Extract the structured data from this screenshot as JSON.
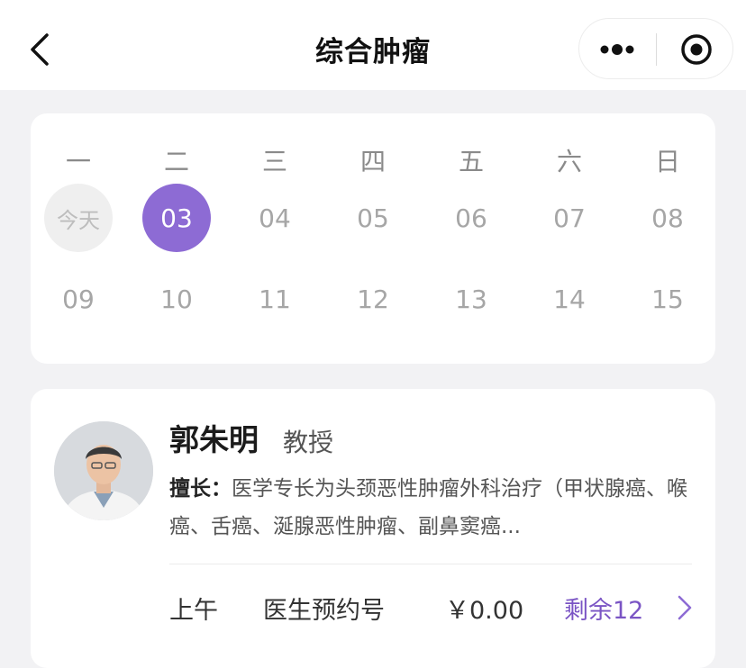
{
  "nav": {
    "title": "综合肿瘤",
    "back_icon": "chevron-left-icon",
    "more_icon": "more-dots-icon",
    "close_icon": "target-close-icon"
  },
  "calendar": {
    "weekdays": [
      "一",
      "二",
      "三",
      "四",
      "五",
      "六",
      "日"
    ],
    "week1": [
      "今天",
      "03",
      "04",
      "05",
      "06",
      "07",
      "08"
    ],
    "week2": [
      "09",
      "10",
      "11",
      "12",
      "13",
      "14",
      "15"
    ],
    "selected_color": "#8d6bd4"
  },
  "doctor": {
    "name": "郭朱明",
    "title": "教授",
    "specialty_label": "擅长：",
    "specialty_text": "医学专长为头颈恶性肿瘤外科治疗（甲状腺癌、喉癌、舌癌、涎腺恶性肿瘤、副鼻窦癌...",
    "slot": {
      "period": "上午",
      "type": "医生预约号",
      "price": "￥0.00",
      "remaining": "剩余12"
    },
    "accent_color": "#7a54c4"
  }
}
